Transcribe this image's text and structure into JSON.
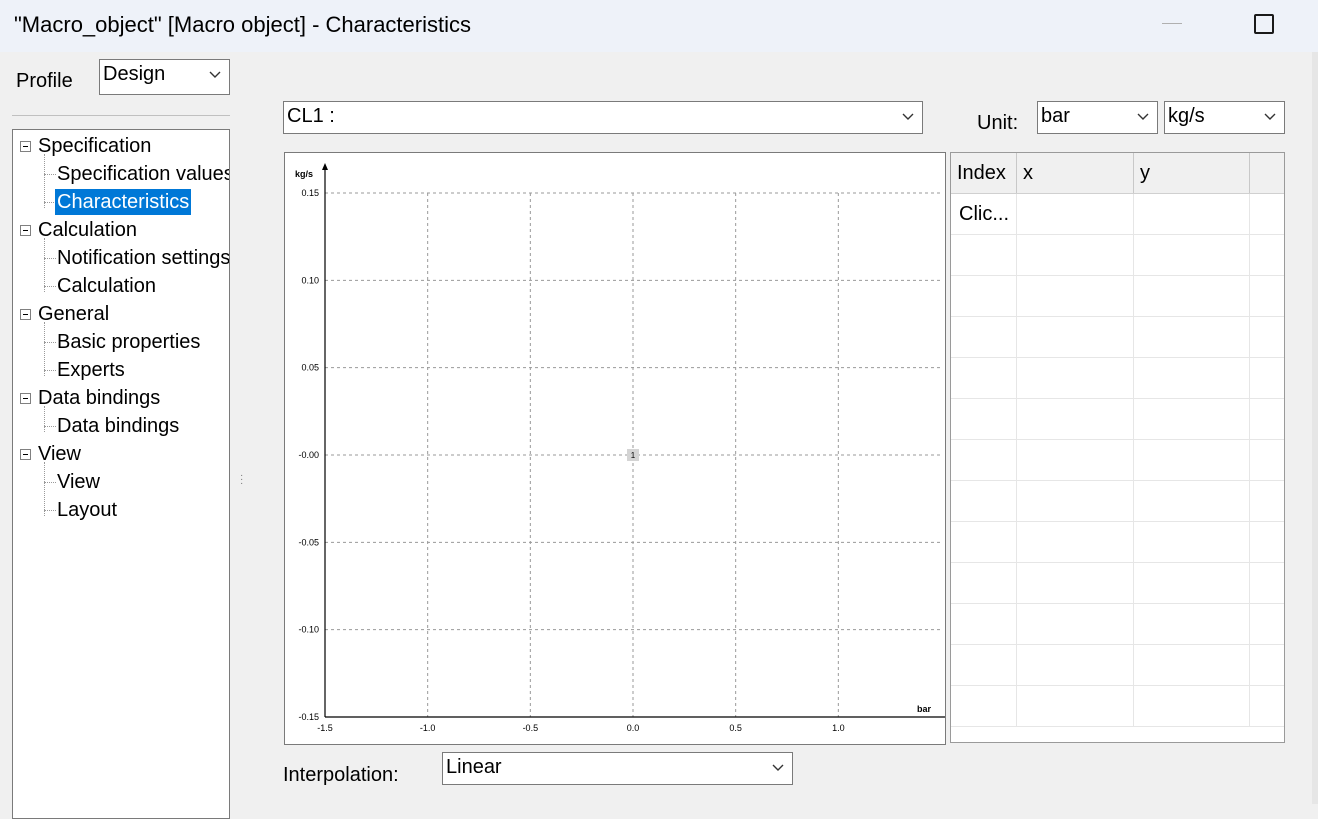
{
  "window": {
    "title": "\"Macro_object\" [Macro object] - Characteristics"
  },
  "profile": {
    "label": "Profile",
    "value": "Design"
  },
  "tree": {
    "items": [
      {
        "label": "Specification"
      },
      {
        "label": "Specification values"
      },
      {
        "label": "Characteristics"
      },
      {
        "label": "Calculation"
      },
      {
        "label": "Notification settings"
      },
      {
        "label": "Calculation"
      },
      {
        "label": "General"
      },
      {
        "label": "Basic properties"
      },
      {
        "label": "Experts"
      },
      {
        "label": "Data bindings"
      },
      {
        "label": "Data bindings"
      },
      {
        "label": "View"
      },
      {
        "label": "View"
      },
      {
        "label": "Layout"
      }
    ]
  },
  "curve_select": {
    "value": "CL1 :"
  },
  "unit": {
    "label": "Unit:",
    "x_unit": "bar",
    "y_unit": "kg/s"
  },
  "chart_data": {
    "type": "scatter",
    "xlabel": "bar",
    "ylabel": "kg/s",
    "xlim": [
      -1.5,
      1.5
    ],
    "ylim": [
      -0.15,
      0.15
    ],
    "x_ticks": [
      "-1.5",
      "-1.0",
      "-0.5",
      "0.0",
      "0.5",
      "1.0"
    ],
    "y_ticks": [
      "0.15",
      "0.10",
      "0.05",
      "-0.00",
      "-0.05",
      "-0.10",
      "-0.15"
    ],
    "grid": true,
    "points": [
      {
        "label": "1",
        "x": 0.0,
        "y": 0.0
      }
    ]
  },
  "table": {
    "columns": [
      "Index",
      "x",
      "y"
    ],
    "rows": [
      {
        "index": "Clic...",
        "x": "",
        "y": ""
      }
    ]
  },
  "interpolation": {
    "label": "Interpolation:",
    "value": "Linear"
  },
  "colors": {
    "selection": "#0078d7",
    "titlebar": "#eef2f9"
  }
}
